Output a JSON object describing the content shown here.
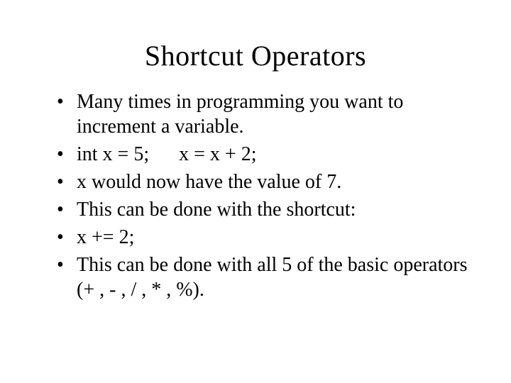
{
  "title": "Shortcut Operators",
  "bullets": [
    "Many times in programming you want to increment a variable.",
    "int x = 5;      x = x + 2;",
    "x would now have the value of 7.",
    "This can be done with the shortcut:",
    "x += 2;",
    "This can be done with all 5 of the basic operators (+ , - , / , * , %)."
  ]
}
